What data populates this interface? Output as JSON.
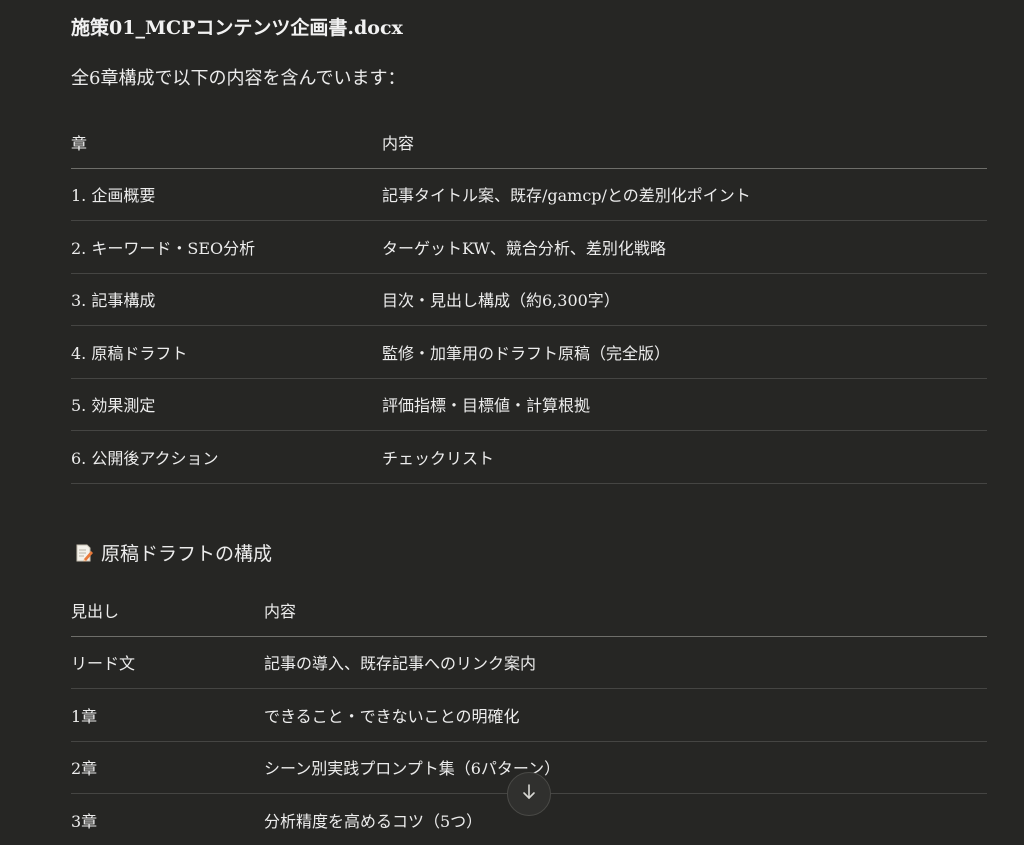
{
  "file_title": "施策01_MCPコンテンツ企画書.docx",
  "intro_text": "全6章構成で以下の内容を含んでいます：",
  "table1": {
    "headers": [
      "章",
      "内容"
    ],
    "rows": [
      [
        "1. 企画概要",
        "記事タイトル案、既存/gamcp/との差別化ポイント"
      ],
      [
        "2. キーワード・SEO分析",
        "ターゲットKW、競合分析、差別化戦略"
      ],
      [
        "3. 記事構成",
        "目次・見出し構成（約6,300字）"
      ],
      [
        "4. 原稿ドラフト",
        "監修・加筆用のドラフト原稿（完全版）"
      ],
      [
        "5. 効果測定",
        "評価指標・目標値・計算根拠"
      ],
      [
        "6. 公開後アクション",
        "チェックリスト"
      ]
    ]
  },
  "section_heading": {
    "icon": "memo-icon",
    "text": "原稿ドラフトの構成"
  },
  "table2": {
    "headers": [
      "見出し",
      "内容"
    ],
    "rows": [
      [
        "リード文",
        "記事の導入、既存記事へのリンク案内"
      ],
      [
        "1章",
        "できること・できないことの明確化"
      ],
      [
        "2章",
        "シーン別実践プロンプト集（6パターン）"
      ],
      [
        "3章",
        "分析精度を高めるコツ（5つ）"
      ]
    ]
  },
  "scroll_button": {
    "icon": "arrow-down-icon",
    "glyph": "↓"
  },
  "colors": {
    "background": "#262624",
    "text": "#ececec",
    "divider": "#454543",
    "header_divider": "#6e6e6a"
  }
}
